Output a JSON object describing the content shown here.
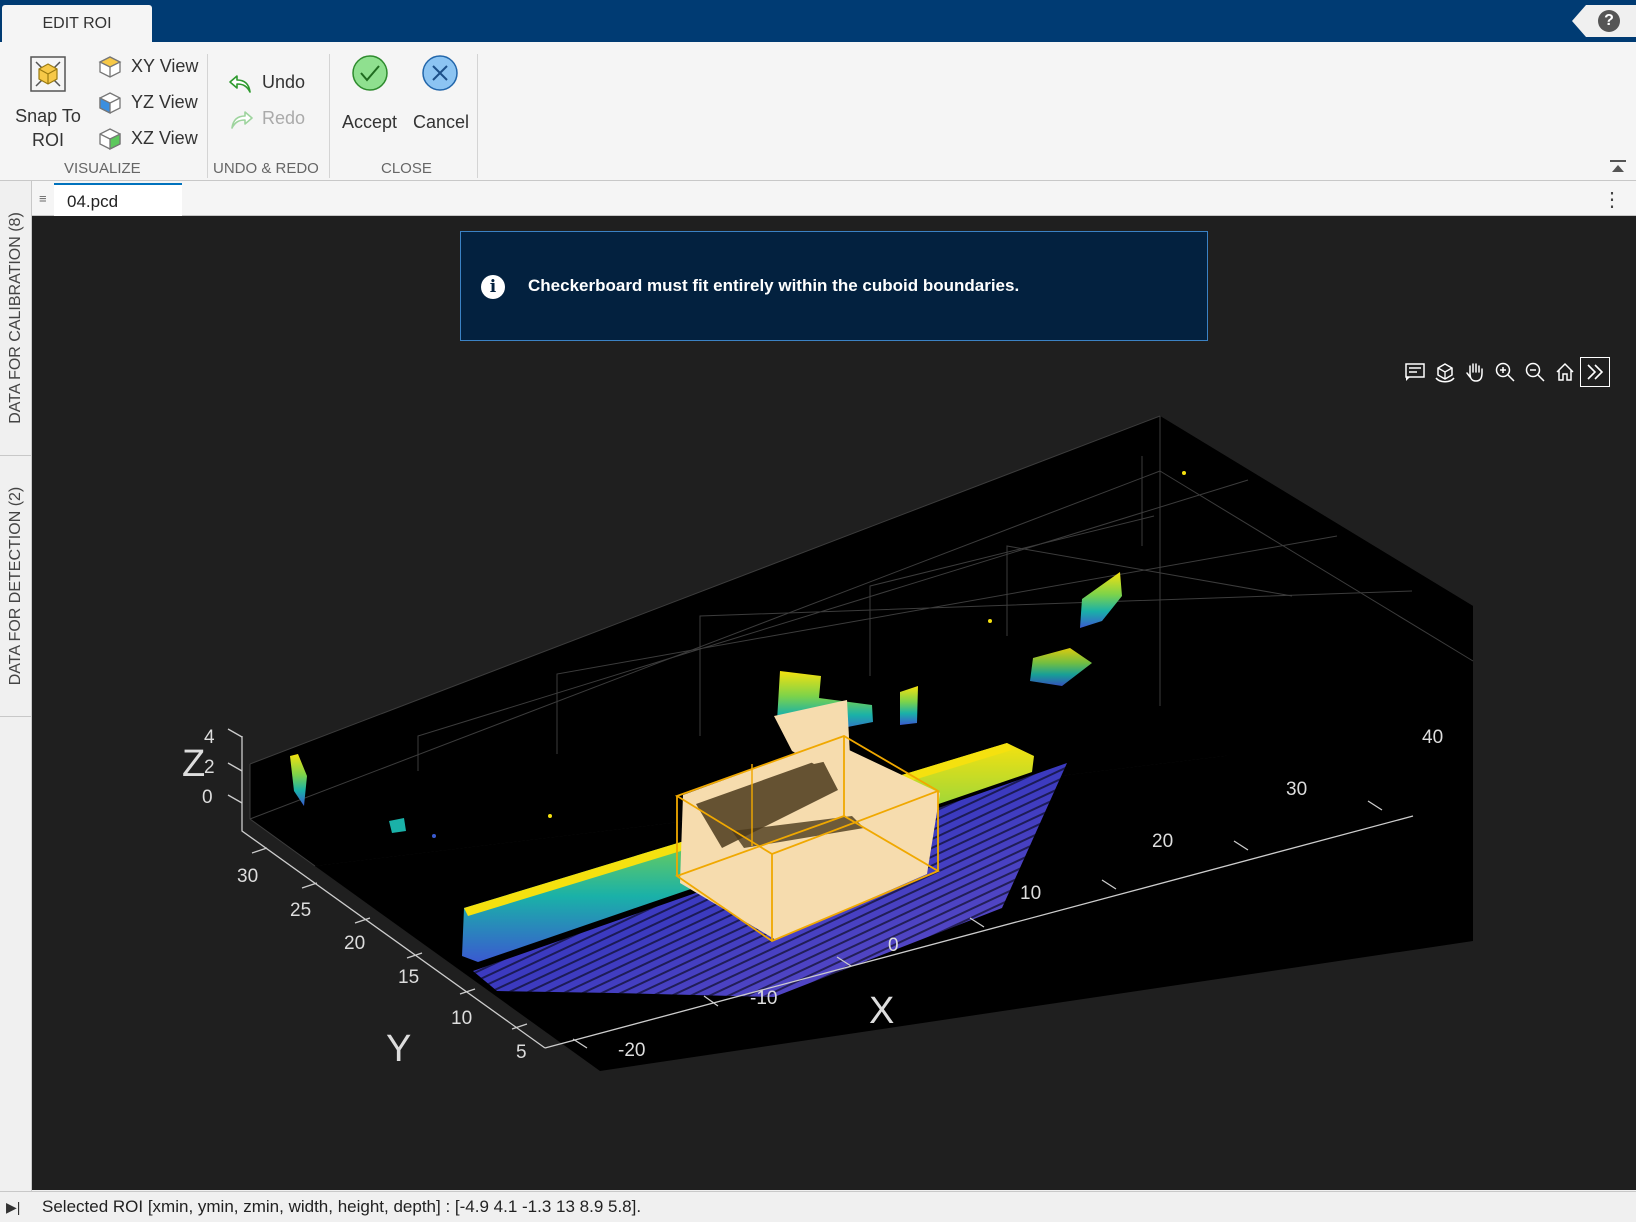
{
  "app": {
    "tab_label": "EDIT ROI"
  },
  "toolstrip": {
    "snap_to_roi_label": "Snap To\nROI",
    "xy_view_label": "XY View",
    "yz_view_label": "YZ View",
    "xz_view_label": "XZ View",
    "visualize_section": "VISUALIZE",
    "undo_label": "Undo",
    "redo_label": "Redo",
    "undo_redo_section": "UNDO & REDO",
    "accept_label": "Accept",
    "cancel_label": "Cancel",
    "close_section": "CLOSE"
  },
  "left_panel": {
    "tabs": [
      {
        "label": "DATA FOR CALIBRATION (8)"
      },
      {
        "label": "DATA FOR DETECTION (2)"
      }
    ]
  },
  "document": {
    "tab_label": "04.pcd"
  },
  "notice": {
    "text": "Checkerboard must fit entirely within the cuboid boundaries."
  },
  "axes": {
    "x_label": "X",
    "y_label": "Y",
    "z_label": "Z",
    "x_ticks": [
      "-20",
      "-10",
      "0",
      "10",
      "20",
      "30",
      "40"
    ],
    "y_ticks": [
      "5",
      "10",
      "15",
      "20",
      "25",
      "30"
    ],
    "z_ticks": [
      "0",
      "2",
      "4"
    ],
    "toolbar_icons": [
      "data-tips-icon",
      "rotate-3d-icon",
      "pan-icon",
      "zoom-in-icon",
      "zoom-out-icon",
      "home-icon",
      "expand-icon"
    ]
  },
  "roi": {
    "xmin": -4.9,
    "ymin": 4.1,
    "zmin": -1.3,
    "width": 13,
    "height": 8.9,
    "depth": 5.8
  },
  "status": {
    "text": "Selected ROI [xmin, ymin, zmin, width, height, depth] : [-4.9 4.1 -1.3 13 8.9 5.8]."
  },
  "colors": {
    "topbar": "#003b73",
    "roi_box": "#f0a800",
    "roi_fill": "#f6dcae"
  }
}
